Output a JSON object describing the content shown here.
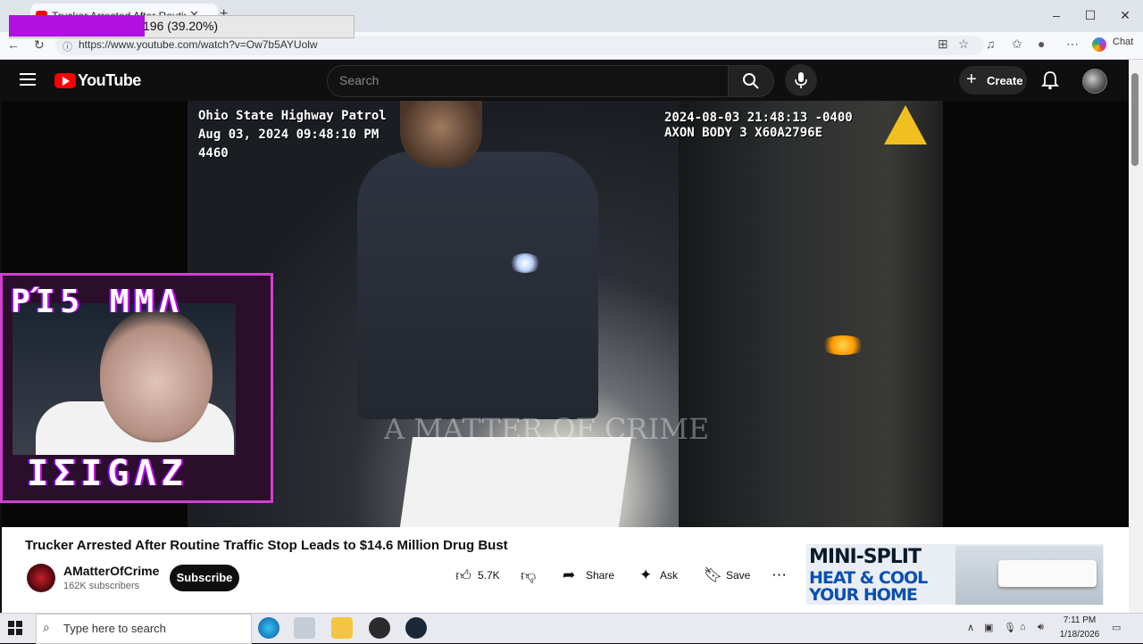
{
  "browser": {
    "tab_title": "Trucker Arrested After Routine",
    "url": "https://www.youtube.com/watch?v=Ow7b5AYUolw",
    "chat_label": "Chat",
    "download_progress": {
      "text": "196 (39.20%)",
      "fraction": 0.392
    }
  },
  "youtube": {
    "logo_text": "YouTube",
    "search_placeholder": "Search",
    "create_label": "Create"
  },
  "video": {
    "overlay_left_line1": "Ohio State Highway Patrol",
    "overlay_left_line2": "Aug 03, 2024 09:48:10 PM",
    "overlay_left_line3": "4460",
    "overlay_right_line1": "2024-08-03 21:48:13 -0400",
    "overlay_right_line2": "AXON BODY 3 X60A2796E",
    "watermark": "A MATTER OF CRIME"
  },
  "webcam": {
    "text_top": "ΡΊ5  ΜΜΛ",
    "text_bottom": "ΙΣΙGΛΖ"
  },
  "details": {
    "title": "Trucker Arrested After Routine Traffic Stop Leads to $14.6 Million Drug Bust",
    "channel_name": "AMatterOfCrime",
    "subscribers": "162K subscribers",
    "subscribe_label": "Subscribe",
    "likes": "5.7K",
    "share_label": "Share",
    "ask_label": "Ask",
    "save_label": "Save"
  },
  "ad": {
    "line1": "MINI-SPLIT",
    "line2": "HEAT & COOL",
    "line3": "YOUR HOME"
  },
  "taskbar": {
    "search_placeholder": "Type here to search",
    "time": "7:11 PM",
    "date": "1/18/2026"
  },
  "colors": {
    "youtube_red": "#ff0000",
    "progress_purple": "#b010e0",
    "ad_blue": "#0b4fb3"
  }
}
